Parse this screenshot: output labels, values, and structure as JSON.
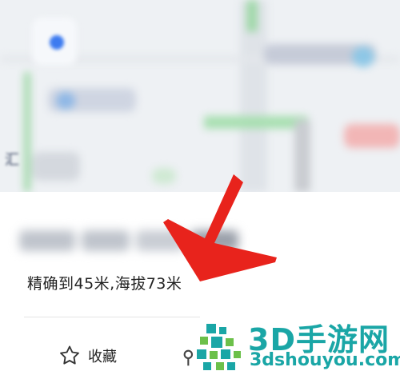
{
  "location": {
    "accuracy_text": "精确到45米,海拔73米"
  },
  "actions": {
    "favorite_label": "收藏"
  },
  "map": {
    "edge_char": "汇"
  },
  "watermark": {
    "title": "3D手游网",
    "url": "3dshouyou.com"
  },
  "colors": {
    "accent_red": "#e8231c",
    "watermark_teal": "#1aa6a6",
    "location_blue": "#3d7bf0"
  }
}
